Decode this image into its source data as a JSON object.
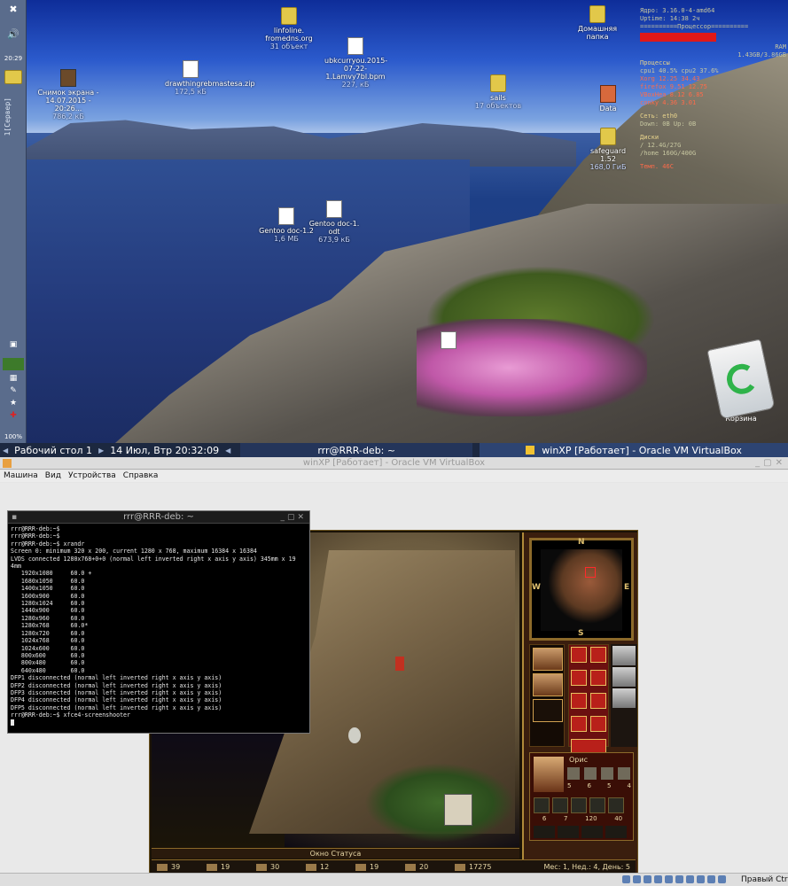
{
  "leftpanel": {
    "clock": "20:29",
    "vertical_label": "1[Сервер]",
    "percent": "100%"
  },
  "desktop_icons": [
    {
      "name": "Снимок экрана - 14.07.2015 - 20:26...",
      "size": "786,2 кБ",
      "type": "image"
    },
    {
      "name": "drawthingrebmastesa.zip",
      "size": "172,5 кБ",
      "type": "archive"
    },
    {
      "name": "linfoline. fromedns.org",
      "size": "31 объект",
      "type": "folder"
    },
    {
      "name": "ubkcurryou.2015-07-22-1.Lamvy7bl.bpm",
      "size": "227,  кБ",
      "type": "doc"
    },
    {
      "name": "sails",
      "size": "17 объектов",
      "type": "folder"
    },
    {
      "name": "Домашняя папка",
      "size": "",
      "type": "folder"
    },
    {
      "name": "Data",
      "size": "",
      "type": "drive"
    },
    {
      "name": "safeguard 1.52",
      "size": "168,0 ГиБ",
      "type": "drive"
    },
    {
      "name": "Gentoo doc-1.2",
      "size": "1,6 МБ",
      "type": "doc"
    },
    {
      "name": "Gentoo doc-1. odt",
      "size": "673,9 кБ",
      "type": "doc"
    },
    {
      "name": "",
      "size": "",
      "type": "doc"
    }
  ],
  "conky": {
    "line1": "Ядро: 3.16.0-4-amd64",
    "line2": "Uptime: 14:38 2ч",
    "line3": "==========Процессор==========",
    "line4": "RAM",
    "line5": "1.43GB/3.86GB",
    "line6": "Процессы",
    "line7": "cpu1  40.5%  cpu2  37.6%",
    "line8": "Xorg    12.25  34.43",
    "line9": "firefox  9.51  12.75",
    "line10": "VBoxHea  8.12  6.85",
    "line11": "conky    4.36  3.01",
    "line12": "Сеть: eth0",
    "line13": "Down: 0B  Up: 0B",
    "line14": "Диски",
    "line15": "/   12.4G/27G",
    "line16": "/home  160G/400G",
    "line17": "Темп. 46C"
  },
  "trash": {
    "label": "Корзина"
  },
  "taskbar": {
    "workspace": "Рабочий стол 1",
    "datetime": "14 Июл, Втр 20:32:09",
    "task1": "rrr@RRR-deb: ~",
    "task2": "winXP [Работает] - Oracle VM VirtualBox"
  },
  "vbox": {
    "title": "winXP [Работает] - Oracle VM VirtualBox",
    "menu": [
      "Машина",
      "Вид",
      "Устройства",
      "Справка"
    ],
    "hostkey": "Правый Ctrl"
  },
  "terminal": {
    "title": "rrr@RRR-deb: ~",
    "lines": [
      "rrr@RRR-deb:~$",
      "rrr@RRR-deb:~$",
      "rrr@RRR-deb:~$ xrandr",
      "Screen 0: minimum 320 x 200, current 1280 x 768, maximum 16384 x 16384",
      "LVDS connected 1280x768+0+0 (normal left inverted right x axis y axis) 345mm x 19",
      "4mm",
      "   1920x1080     60.0 +",
      "   1680x1050     60.0",
      "   1400x1050     60.0",
      "   1600x900      60.0",
      "   1280x1024     60.0",
      "   1440x900      60.0",
      "   1280x960      60.0",
      "   1280x768      60.0*",
      "   1280x720      60.0",
      "   1024x768      60.0",
      "   1024x600      60.0",
      "   800x600       60.0",
      "   800x480       60.0",
      "   640x480       60.0",
      "DFP1 disconnected (normal left inverted right x axis y axis)",
      "DFP2 disconnected (normal left inverted right x axis y axis)",
      "DFP3 disconnected (normal left inverted right x axis y axis)",
      "DFP4 disconnected (normal left inverted right x axis y axis)",
      "DFP5 disconnected (normal left inverted right x axis y axis)",
      "rrr@RRR-deb:~$ xfce4-screenshooter"
    ]
  },
  "game": {
    "status_window": "Окно Статуса",
    "hero_name": "Орис",
    "hero_stats": [
      "5",
      "6",
      "5",
      "4"
    ],
    "army_counts": [
      "6",
      "7",
      "120",
      "40"
    ],
    "compass": {
      "n": "N",
      "s": "S",
      "w": "W",
      "e": "E"
    },
    "resources": [
      "39",
      "19",
      "30",
      "12",
      "19",
      "20",
      "17275"
    ],
    "date": "Мес: 1, Нед.: 4, День: 5"
  }
}
